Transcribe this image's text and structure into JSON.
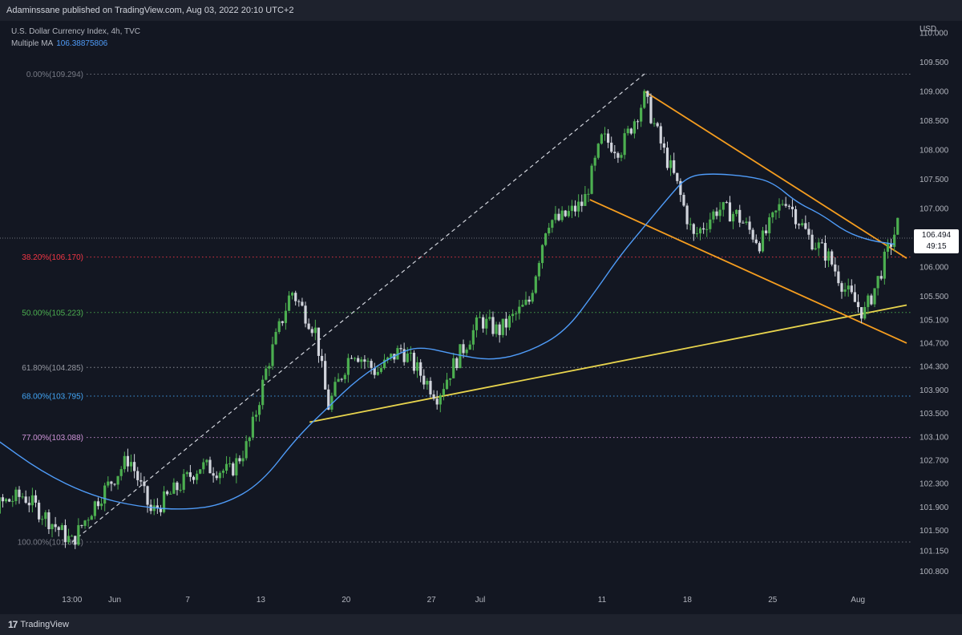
{
  "header": {
    "published": "Adaminssane published on TradingView.com, Aug 03, 2022 20:10 UTC+2"
  },
  "legend": {
    "symbol": "U.S. Dollar Currency Index, 4h, TVC",
    "ma_label": "Multiple MA",
    "ma_value": "106.38875806"
  },
  "price_tag": {
    "price": "106.494",
    "countdown": "49:15"
  },
  "footer": {
    "brand": "TradingView"
  },
  "colors": {
    "background": "#131722",
    "up": "#4caf50",
    "down": "#d1d4dc",
    "ma": "#4f9cf9",
    "channel": "#f59d1f",
    "support": "#e8d44d"
  },
  "chart_data": {
    "type": "candlestick",
    "title": "U.S. Dollar Currency Index, 4h, TVC",
    "currency": "USD",
    "ylim": [
      100.55,
      110.15
    ],
    "y_ticks": [
      "110.000",
      "109.500",
      "109.000",
      "108.500",
      "108.000",
      "107.500",
      "107.000",
      "106.500",
      "106.000",
      "105.500",
      "105.100",
      "104.700",
      "104.300",
      "103.900",
      "103.500",
      "103.100",
      "102.700",
      "102.300",
      "101.900",
      "101.500",
      "101.150",
      "100.800"
    ],
    "x_ticks": [
      {
        "label": "13:00",
        "day": -3.5
      },
      {
        "label": "Jun",
        "day": 0
      },
      {
        "label": "7",
        "day": 6
      },
      {
        "label": "13",
        "day": 12
      },
      {
        "label": "20",
        "day": 19
      },
      {
        "label": "27",
        "day": 26
      },
      {
        "label": "Jul",
        "day": 30
      },
      {
        "label": "11",
        "day": 40
      },
      {
        "label": "18",
        "day": 47
      },
      {
        "label": "25",
        "day": 54
      },
      {
        "label": "Aug",
        "day": 61
      }
    ],
    "fib_levels": [
      {
        "label": "0.00%(109.294)",
        "value": 109.294,
        "color": "#787b86"
      },
      {
        "label": "38.20%(106.170)",
        "value": 106.17,
        "color": "#f23645"
      },
      {
        "label": "50.00%(105.223)",
        "value": 105.223,
        "color": "#4caf50"
      },
      {
        "label": "61.80%(104.285)",
        "value": 104.285,
        "color": "#9598a1"
      },
      {
        "label": "68.00%(103.795)",
        "value": 103.795,
        "color": "#42a5f5"
      },
      {
        "label": "77.00%(103.088)",
        "value": 103.088,
        "color": "#ce93d8"
      },
      {
        "label": "100.00%(101.304)",
        "value": 101.304,
        "color": "#787b86"
      }
    ],
    "last_price": 106.494,
    "anchors": [
      {
        "day": -13.5,
        "price": 102.3
      },
      {
        "day": -10,
        "price": 101.9
      },
      {
        "day": -7.5,
        "price": 102.1
      },
      {
        "day": -5,
        "price": 101.6
      },
      {
        "day": -3.5,
        "price": 101.3
      },
      {
        "day": -1.5,
        "price": 102.0
      },
      {
        "day": 1.2,
        "price": 102.75
      },
      {
        "day": 3,
        "price": 101.8
      },
      {
        "day": 5,
        "price": 102.2
      },
      {
        "day": 7,
        "price": 102.6
      },
      {
        "day": 9.5,
        "price": 102.5
      },
      {
        "day": 11,
        "price": 103.0
      },
      {
        "day": 12.5,
        "price": 104.3
      },
      {
        "day": 14.5,
        "price": 105.6
      },
      {
        "day": 16.5,
        "price": 104.9
      },
      {
        "day": 17.5,
        "price": 103.6
      },
      {
        "day": 19.5,
        "price": 104.6
      },
      {
        "day": 21.5,
        "price": 104.2
      },
      {
        "day": 23.5,
        "price": 104.6
      },
      {
        "day": 26.5,
        "price": 103.8
      },
      {
        "day": 28,
        "price": 104.4
      },
      {
        "day": 30,
        "price": 105.1
      },
      {
        "day": 31.5,
        "price": 104.9
      },
      {
        "day": 34,
        "price": 105.4
      },
      {
        "day": 35.5,
        "price": 106.8
      },
      {
        "day": 36.5,
        "price": 106.8
      },
      {
        "day": 38.5,
        "price": 107.1
      },
      {
        "day": 40,
        "price": 108.2
      },
      {
        "day": 41.5,
        "price": 108.0
      },
      {
        "day": 43.5,
        "price": 108.9
      },
      {
        "day": 45,
        "price": 108.0
      },
      {
        "day": 46,
        "price": 107.5
      },
      {
        "day": 47.5,
        "price": 106.5
      },
      {
        "day": 49.5,
        "price": 107.0
      },
      {
        "day": 51,
        "price": 106.9
      },
      {
        "day": 53,
        "price": 106.4
      },
      {
        "day": 55,
        "price": 107.2
      },
      {
        "day": 57,
        "price": 106.5
      },
      {
        "day": 58.5,
        "price": 106.2
      },
      {
        "day": 60,
        "price": 105.6
      },
      {
        "day": 61.5,
        "price": 105.2
      },
      {
        "day": 62.5,
        "price": 105.7
      },
      {
        "day": 63.5,
        "price": 106.3
      },
      {
        "day": 64.3,
        "price": 106.75
      }
    ],
    "ma_points": [
      {
        "day": -13.5,
        "price": 103.6
      },
      {
        "day": -10,
        "price": 103.1
      },
      {
        "day": -6,
        "price": 102.5
      },
      {
        "day": -2,
        "price": 102.1
      },
      {
        "day": 2,
        "price": 101.9
      },
      {
        "day": 6,
        "price": 101.85
      },
      {
        "day": 9,
        "price": 101.95
      },
      {
        "day": 12,
        "price": 102.3
      },
      {
        "day": 15,
        "price": 103.1
      },
      {
        "day": 17.5,
        "price": 103.6
      },
      {
        "day": 20,
        "price": 104.1
      },
      {
        "day": 23,
        "price": 104.5
      },
      {
        "day": 25,
        "price": 104.65
      },
      {
        "day": 28,
        "price": 104.5
      },
      {
        "day": 31,
        "price": 104.4
      },
      {
        "day": 34,
        "price": 104.55
      },
      {
        "day": 37,
        "price": 104.9
      },
      {
        "day": 39.5,
        "price": 105.6
      },
      {
        "day": 41.5,
        "price": 106.2
      },
      {
        "day": 43.5,
        "price": 106.7
      },
      {
        "day": 45.5,
        "price": 107.2
      },
      {
        "day": 47,
        "price": 107.55
      },
      {
        "day": 49,
        "price": 107.6
      },
      {
        "day": 52,
        "price": 107.55
      },
      {
        "day": 54,
        "price": 107.45
      },
      {
        "day": 56,
        "price": 107.1
      },
      {
        "day": 58,
        "price": 106.9
      },
      {
        "day": 60,
        "price": 106.6
      },
      {
        "day": 62,
        "price": 106.45
      },
      {
        "day": 64,
        "price": 106.39
      }
    ],
    "drawings": {
      "fib_diagonal": [
        {
          "day": -3.5,
          "price": 101.3
        },
        {
          "day": 43.5,
          "price": 109.3
        }
      ],
      "channel_upper": [
        {
          "day": 43.5,
          "price": 109.0
        },
        {
          "day": 65,
          "price": 106.15
        }
      ],
      "channel_lower": [
        {
          "day": 39,
          "price": 107.15
        },
        {
          "day": 65,
          "price": 104.7
        }
      ],
      "support": [
        {
          "day": 16,
          "price": 103.35
        },
        {
          "day": 65,
          "price": 105.35
        }
      ]
    }
  }
}
